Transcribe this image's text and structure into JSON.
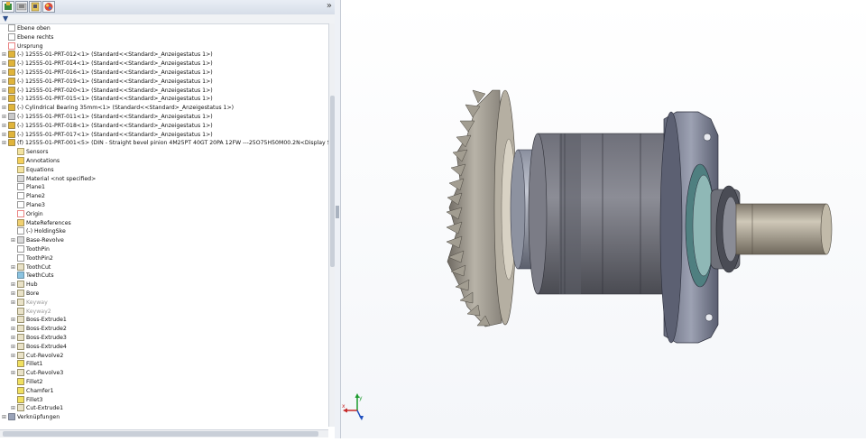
{
  "toolbar": {
    "tabs": [
      "feature-manager-icon",
      "property-manager-icon",
      "configuration-manager-icon",
      "display-manager-icon"
    ],
    "expand": "»",
    "filter": "▼"
  },
  "tree": [
    {
      "label": "Ebene oben",
      "icon": "plane-icon",
      "indent": 0
    },
    {
      "label": "Ebene rechts",
      "icon": "plane-icon",
      "indent": 0
    },
    {
      "label": "Ursprung",
      "icon": "origin-icon",
      "indent": 0
    },
    {
      "label": "(-) 12555-01-PRT-012<1> (Standard<<Standard>_Anzeigestatus 1>)",
      "icon": "part-icon",
      "indent": 0,
      "expand": true
    },
    {
      "label": "(-) 12555-01-PRT-014<1> (Standard<<Standard>_Anzeigestatus 1>)",
      "icon": "part-icon",
      "indent": 0,
      "expand": true
    },
    {
      "label": "(-) 12555-01-PRT-016<1> (Standard<<Standard>_Anzeigestatus 1>)",
      "icon": "part-icon",
      "indent": 0,
      "expand": true
    },
    {
      "label": "(-) 12555-01-PRT-019<1> (Standard<<Standard>_Anzeigestatus 1>)",
      "icon": "part-icon",
      "indent": 0,
      "expand": true
    },
    {
      "label": "(-) 12555-01-PRT-020<1> (Standard<<Standard>_Anzeigestatus 1>)",
      "icon": "part-icon",
      "indent": 0,
      "expand": true
    },
    {
      "label": "(-) 12555-01-PRT-015<1> (Standard<<Standard>_Anzeigestatus 1>)",
      "icon": "part-icon",
      "indent": 0,
      "expand": true
    },
    {
      "label": "(-) Cylindrical Bearing 35mm<1> (Standard<<Standard>_Anzeigestatus 1>)",
      "icon": "part-icon",
      "indent": 0,
      "expand": true
    },
    {
      "label": "(-) 12555-01-PRT-011<1> (Standard<<Standard>_Anzeigestatus 1>)",
      "icon": "part-grey-icon",
      "indent": 0,
      "expand": true
    },
    {
      "label": "(-) 12555-01-PRT-018<1> (Standard<<Standard>_Anzeigestatus 1>)",
      "icon": "part-icon",
      "indent": 0,
      "expand": true
    },
    {
      "label": "(-) 12555-01-PRT-017<1> (Standard<<Standard>_Anzeigestatus 1>)",
      "icon": "part-icon",
      "indent": 0,
      "expand": true
    },
    {
      "label": "(f) 12555-01-PRT-001<5> (DIN - Straight bevel pinion 4M25PT 40GT 20PA 12FW ---25O75H50M00.2N<Display State-5>",
      "icon": "part-icon",
      "indent": 0,
      "expand": true
    },
    {
      "label": "Sensors",
      "icon": "sensor-icon",
      "indent": 1
    },
    {
      "label": "Annotations",
      "icon": "annotation-icon",
      "indent": 1
    },
    {
      "label": "Equations",
      "icon": "equation-icon",
      "indent": 1
    },
    {
      "label": "Material <not specified>",
      "icon": "material-icon",
      "indent": 1
    },
    {
      "label": "Plane1",
      "icon": "plane-icon",
      "indent": 1
    },
    {
      "label": "Plane2",
      "icon": "plane-icon",
      "indent": 1
    },
    {
      "label": "Plane3",
      "icon": "plane-icon",
      "indent": 1
    },
    {
      "label": "Origin",
      "icon": "origin-icon",
      "indent": 1
    },
    {
      "label": "MateReferences",
      "icon": "mate-reference-icon",
      "indent": 1
    },
    {
      "label": "(-) HoldingSke",
      "icon": "sketch-icon",
      "indent": 1
    },
    {
      "label": "Base-Revolve",
      "icon": "revolve-icon",
      "indent": 1,
      "expand": true
    },
    {
      "label": "ToothPin",
      "icon": "sketch-icon",
      "indent": 1
    },
    {
      "label": "ToothPin2",
      "icon": "sketch-icon",
      "indent": 1
    },
    {
      "label": "ToothCut",
      "icon": "cut-icon",
      "indent": 1,
      "expand": true
    },
    {
      "label": "TeethCuts",
      "icon": "pattern-icon",
      "indent": 1
    },
    {
      "label": "Hub",
      "icon": "extrude-icon",
      "indent": 1,
      "expand": true
    },
    {
      "label": "Bore",
      "icon": "cut-icon",
      "indent": 1,
      "expand": true
    },
    {
      "label": "Keyway",
      "icon": "cut-icon",
      "indent": 1,
      "expand": true,
      "greyed": true
    },
    {
      "label": "Keyway2",
      "icon": "cut-icon",
      "indent": 1,
      "greyed": true
    },
    {
      "label": "Boss-Extrude1",
      "icon": "extrude-icon",
      "indent": 1,
      "expand": true
    },
    {
      "label": "Boss-Extrude2",
      "icon": "extrude-icon",
      "indent": 1,
      "expand": true
    },
    {
      "label": "Boss-Extrude3",
      "icon": "extrude-icon",
      "indent": 1,
      "expand": true
    },
    {
      "label": "Boss-Extrude4",
      "icon": "extrude-icon",
      "indent": 1,
      "expand": true
    },
    {
      "label": "Cut-Revolve2",
      "icon": "cut-icon",
      "indent": 1,
      "expand": true
    },
    {
      "label": "Fillet1",
      "icon": "fillet-icon",
      "indent": 1
    },
    {
      "label": "Cut-Revolve3",
      "icon": "cut-icon",
      "indent": 1,
      "expand": true
    },
    {
      "label": "Fillet2",
      "icon": "fillet-icon",
      "indent": 1
    },
    {
      "label": "Chamfer1",
      "icon": "chamfer-icon",
      "indent": 1
    },
    {
      "label": "Fillet3",
      "icon": "fillet-icon",
      "indent": 1
    },
    {
      "label": "Cut-Extrude1",
      "icon": "cut-icon",
      "indent": 1,
      "expand": true
    },
    {
      "label": "Verknüpfungen",
      "icon": "mates-icon",
      "indent": 0,
      "expand": true
    }
  ],
  "triad": {
    "x": "x",
    "y": "y"
  }
}
